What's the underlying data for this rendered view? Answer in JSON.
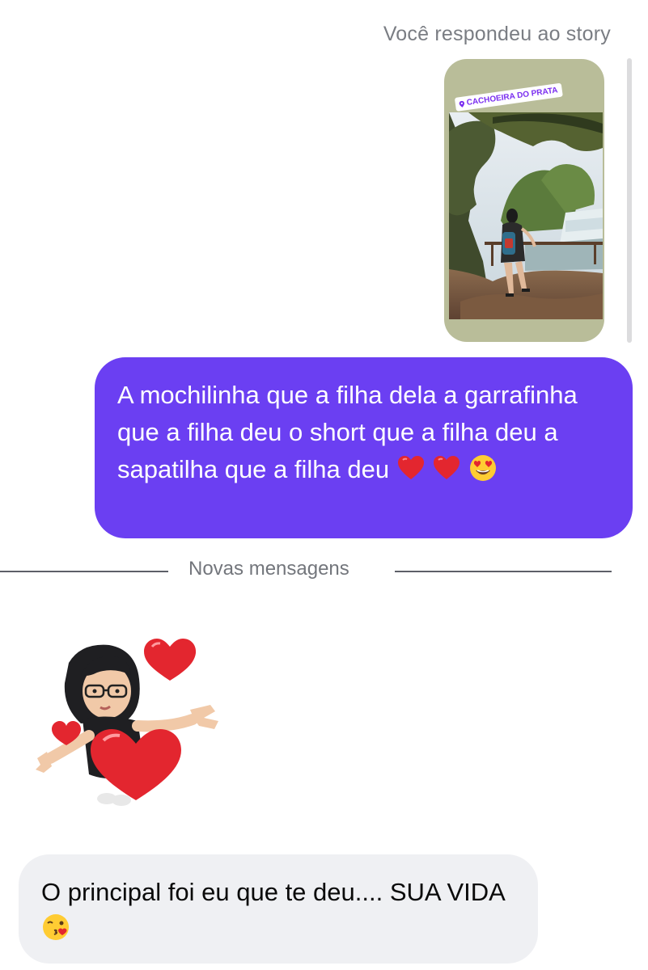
{
  "story_reply": {
    "caption": "Você respondeu ao story",
    "location_sticker": "CACHOEIRA DO PRATA",
    "pin_icon": "location-pin-icon",
    "card_background": "#b9bd99",
    "sticker_color": "#7b2ff0"
  },
  "sent_message": {
    "text": "A mochilinha que a filha dela a garrafinha que a filha deu o short que a filha deu a sapatilha que a filha deu",
    "emojis": [
      "red-heart",
      "red-heart",
      "heart-eyes-face"
    ],
    "bubble_color": "#6b3ff2"
  },
  "divider": {
    "label": "Novas mensagens"
  },
  "received_sticker": {
    "description_icon": "avatar-hearts-sticker"
  },
  "received_message": {
    "text": "O principal foi eu que te deu.... SUA VIDA",
    "emojis": [
      "kissing-wink-face"
    ],
    "bubble_color": "#eff0f3"
  }
}
